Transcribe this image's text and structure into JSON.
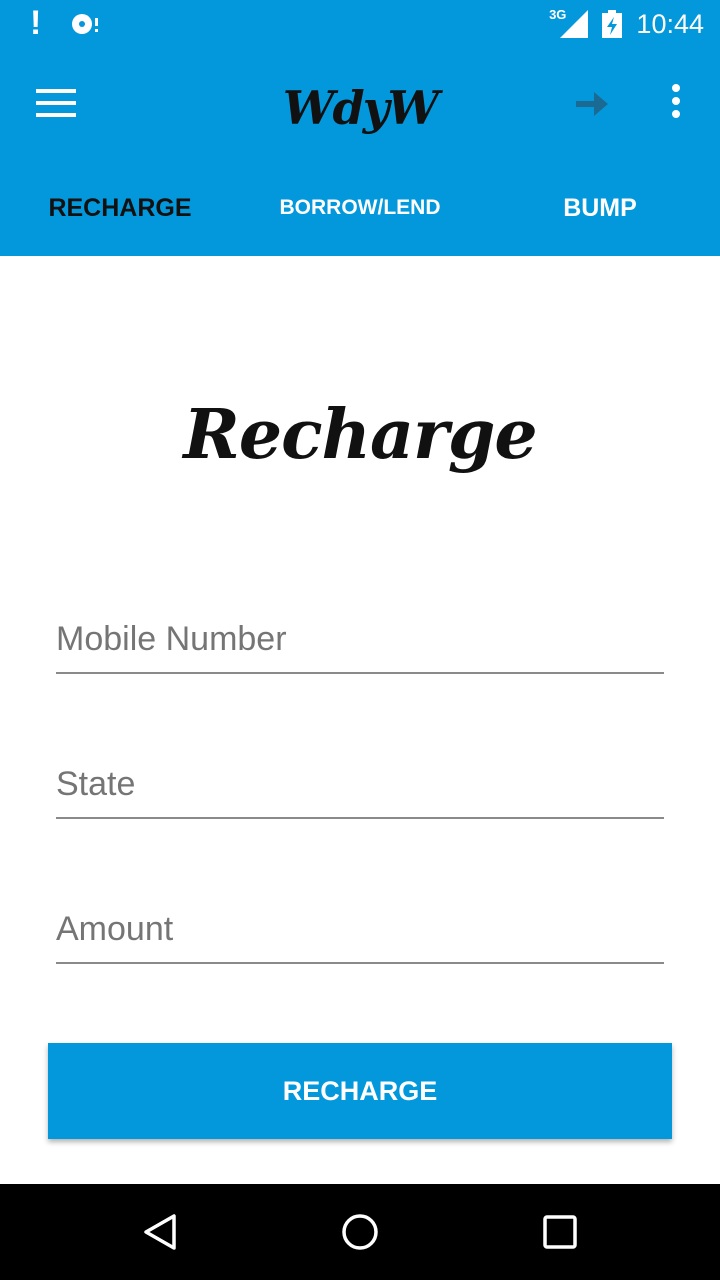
{
  "status_bar": {
    "network_type": "3G",
    "time": "10:44",
    "icons": [
      "alert-icon",
      "disc-icon",
      "signal-icon",
      "battery-icon"
    ]
  },
  "app_bar": {
    "logo_text": "WdyW",
    "icons": [
      "menu-icon",
      "arrow-right-icon",
      "more-vert-icon"
    ]
  },
  "tabs": [
    {
      "label": "RECHARGE",
      "active": true
    },
    {
      "label": "BORROW/LEND",
      "active": false
    },
    {
      "label": "BUMP",
      "active": false
    }
  ],
  "page": {
    "heading": "Recharge",
    "fields": {
      "mobile": {
        "placeholder": "Mobile Number",
        "value": ""
      },
      "state": {
        "placeholder": "State",
        "value": ""
      },
      "amount": {
        "placeholder": "Amount",
        "value": ""
      }
    },
    "submit_label": "RECHARGE"
  },
  "nav_bar": {
    "icons": [
      "back-icon",
      "home-icon",
      "recents-icon"
    ]
  },
  "colors": {
    "primary": "#0398dc",
    "active_tab_text": "#111111",
    "tab_text": "#ffffff",
    "nav_bar": "#000000"
  }
}
